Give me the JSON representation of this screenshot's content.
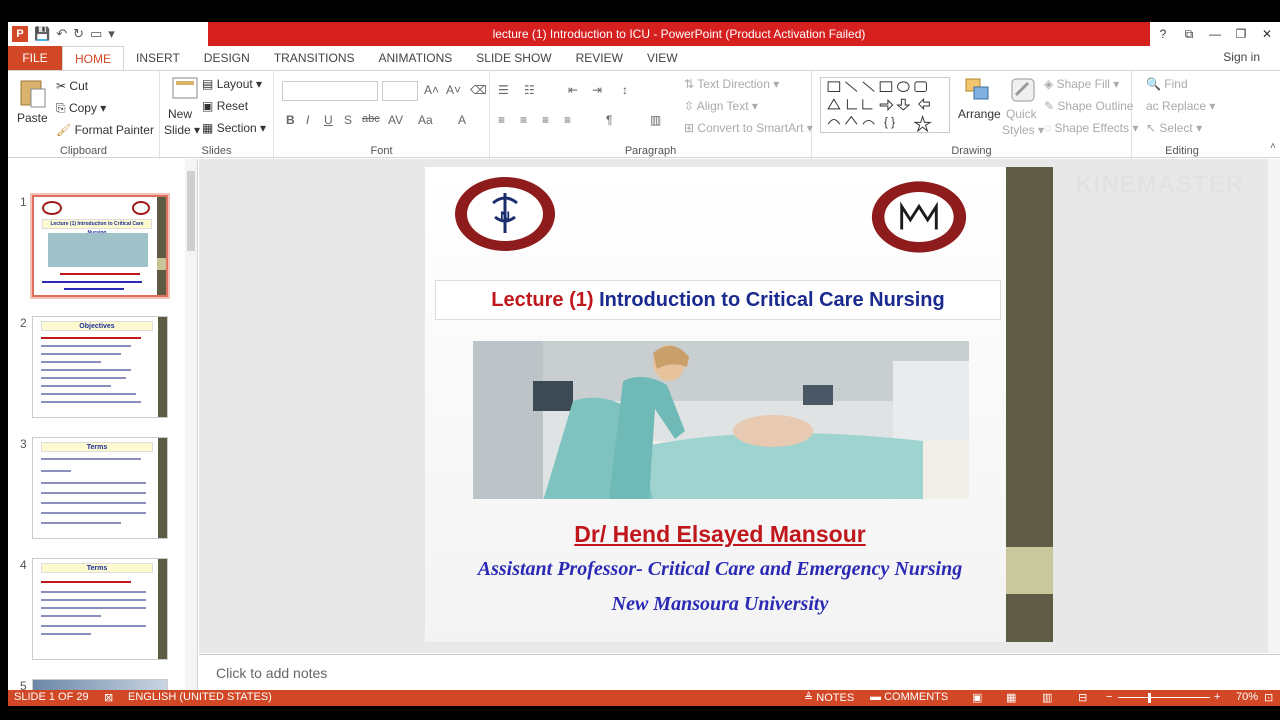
{
  "titlebar": {
    "title": "lecture (1) Introduction to ICU -  PowerPoint (Product Activation Failed)",
    "controls": [
      "?",
      "⧉",
      "—",
      "❐",
      "✕"
    ]
  },
  "tabs": [
    "FILE",
    "HOME",
    "INSERT",
    "DESIGN",
    "TRANSITIONS",
    "ANIMATIONS",
    "SLIDE SHOW",
    "REVIEW",
    "VIEW"
  ],
  "sign_in": "Sign in",
  "ribbon": {
    "clipboard": {
      "label": "Clipboard",
      "paste": "Paste",
      "cut": "Cut",
      "copy": "Copy",
      "format_painter": "Format Painter"
    },
    "slides": {
      "label": "Slides",
      "new_slide_1": "New",
      "new_slide_2": "Slide",
      "layout": "Layout",
      "reset": "Reset",
      "section": "Section"
    },
    "font": {
      "label": "Font"
    },
    "paragraph": {
      "label": "Paragraph",
      "text_direction": "Text Direction",
      "align_text": "Align Text",
      "convert": "Convert to SmartArt"
    },
    "drawing": {
      "label": "Drawing",
      "arrange": "Arrange",
      "quick_styles_1": "Quick",
      "quick_styles_2": "Styles",
      "shape_fill": "Shape Fill",
      "shape_outline": "Shape Outline",
      "shape_effects": "Shape Effects"
    },
    "editing": {
      "label": "Editing",
      "find": "Find",
      "replace": "Replace",
      "select": "Select"
    }
  },
  "thumbnails": [
    {
      "num": "1",
      "title": "Lecture (1) Introduction to Critical Care Nursing"
    },
    {
      "num": "2",
      "title": "Objectives"
    },
    {
      "num": "3",
      "title": "Terms"
    },
    {
      "num": "4",
      "title": "Terms"
    },
    {
      "num": "5",
      "title": ""
    }
  ],
  "slide": {
    "title_red": "Lecture (1)",
    "title_blue": "Introduction to Critical Care Nursing",
    "author": "Dr/ Hend Elsayed Mansour",
    "position": "Assistant Professor- Critical Care and Emergency Nursing",
    "university": "New Mansoura University"
  },
  "watermark": "KINEMASTER",
  "notes_placeholder": "Click to add notes",
  "status": {
    "slide_count": "SLIDE 1 OF 29",
    "language": "ENGLISH (UNITED STATES)",
    "notes": "NOTES",
    "comments": "COMMENTS",
    "zoom": "70%"
  },
  "colors": {
    "accent": "#d24726",
    "title_red": "#d61f1f",
    "slide_sidebar": "#5f5c45"
  }
}
